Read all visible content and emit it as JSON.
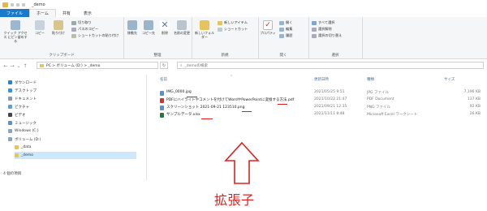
{
  "window": {
    "title": "_demo"
  },
  "tabs": {
    "file": "ファイル",
    "home": "ホーム",
    "share": "共有",
    "view": "表示"
  },
  "ribbon": {
    "quick_access": {
      "pin": "クイック アクセス にピン留めする",
      "copy": "コピー",
      "paste": "貼り付け",
      "cut": "切り取り",
      "copy_path": "パスのコピー",
      "paste_shortcut": "ショートカットの貼り付け"
    },
    "clipboard_label": "クリップボード",
    "organize": {
      "move": "移動先",
      "copyto": "コピー先",
      "delete": "削除",
      "rename": "名前の変更"
    },
    "organize_label": "整理",
    "new": {
      "folder": "新しいフォルダー",
      "new_item": "新しいアイテム",
      "easy_access": "ショートカット"
    },
    "new_label": "新規",
    "open": {
      "properties": "プロパティ",
      "open": "開く",
      "edit": "編集",
      "history": "履歴"
    },
    "open_label": "開く",
    "select": {
      "all": "すべて選択",
      "none": "選択解除",
      "invert": "選択の切り替え"
    },
    "select_label": "選択"
  },
  "address": {
    "path": "PC  >  ボリューム (D:)  >  _demo",
    "search_placeholder": "_demoの検索"
  },
  "nav": {
    "items": [
      "ダウンロード",
      "デスクトップ",
      "ドキュメント",
      "ピクチャ",
      "ビデオ",
      "ミュージック",
      "Windows (C:)",
      "ボリューム (D:)",
      "_data",
      "_demo"
    ]
  },
  "status": "4 個の項目",
  "columns": {
    "name": "名前",
    "date": "更新日時",
    "type": "種類",
    "size": "サイズ"
  },
  "files": [
    {
      "name": "IMG_0000.jpg",
      "date": "2021/05/25 9:51",
      "type": "JPG ファイル",
      "size": "7,196 KB"
    },
    {
      "name": "PDFにハイライトやコメントを付けてWordやPowerPointに変換する方法.pdf",
      "date": "2021/10/22 21:47",
      "type": "PDF Document",
      "size": "137 KB"
    },
    {
      "name": "スクリーンショット 2021-09-21 123510.png",
      "date": "2021/09/21 12:35",
      "type": "PNG ファイル",
      "size": "92 KB"
    },
    {
      "name": "サンプルデータ.xlsx",
      "date": "2021/11/11 8:48",
      "type": "Microsoft Excel ワークシート",
      "size": "26 KB"
    }
  ],
  "annotation": {
    "label": "拡張子"
  },
  "colors": {
    "accent": "#1979ca",
    "annotation": "#e02020"
  }
}
